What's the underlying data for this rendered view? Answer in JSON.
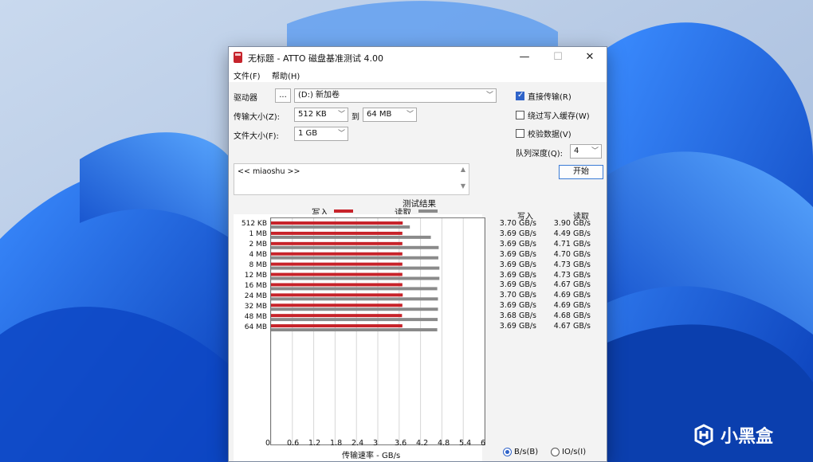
{
  "window": {
    "title": "无标题 - ATTO 磁盘基准测试 4.00",
    "minimize": "—",
    "maximize": "☐",
    "close": "✕"
  },
  "menu": {
    "file": "文件(F)",
    "help": "帮助(H)"
  },
  "controls": {
    "drive_label": "驱动器",
    "browse": "...",
    "drive_value": "(D:) 新加卷",
    "transfer_label": "传输大小(Z):",
    "transfer_from": "512 KB",
    "to_label": "到",
    "transfer_to": "64 MB",
    "file_size_label": "文件大小(F):",
    "file_size": "1 GB",
    "direct_io": "直接传输(R)",
    "bypass_cache": "绕过写入缓存(W)",
    "verify_data": "校验数据(V)",
    "queue_label": "队列深度(Q):",
    "queue_value": "4",
    "start": "开始",
    "notes": "<< miaoshu >>"
  },
  "results": {
    "legend_title": "测试结果",
    "write_label": "写入",
    "read_label": "读取",
    "col_write": "写入",
    "col_read": "读取",
    "axis_title": "传输速率 - GB/s",
    "unit_bs": "B/s(B)",
    "unit_ios": "IO/s(I)"
  },
  "chart_data": {
    "type": "bar",
    "orientation": "horizontal",
    "categories": [
      "512 KB",
      "1 MB",
      "2 MB",
      "4 MB",
      "8 MB",
      "12 MB",
      "16 MB",
      "24 MB",
      "32 MB",
      "48 MB",
      "64 MB"
    ],
    "series": [
      {
        "name": "写入",
        "color": "#c7232a",
        "values": [
          3.7,
          3.69,
          3.69,
          3.69,
          3.69,
          3.69,
          3.69,
          3.7,
          3.69,
          3.68,
          3.69
        ]
      },
      {
        "name": "读取",
        "color": "#8a8a8a",
        "values": [
          3.9,
          4.49,
          4.71,
          4.7,
          4.73,
          4.73,
          4.67,
          4.69,
          4.69,
          4.68,
          4.67
        ]
      }
    ],
    "write_text": [
      "3.70 GB/s",
      "3.69 GB/s",
      "3.69 GB/s",
      "3.69 GB/s",
      "3.69 GB/s",
      "3.69 GB/s",
      "3.69 GB/s",
      "3.70 GB/s",
      "3.69 GB/s",
      "3.68 GB/s",
      "3.69 GB/s"
    ],
    "read_text": [
      "3.90 GB/s",
      "4.49 GB/s",
      "4.71 GB/s",
      "4.70 GB/s",
      "4.73 GB/s",
      "4.73 GB/s",
      "4.67 GB/s",
      "4.69 GB/s",
      "4.69 GB/s",
      "4.68 GB/s",
      "4.67 GB/s"
    ],
    "xticks": [
      "0",
      "0.6",
      "1.2",
      "1.8",
      "2.4",
      "3",
      "3.6",
      "4.2",
      "4.8",
      "5.4",
      "6"
    ],
    "xlim": [
      0,
      6
    ],
    "xlabel": "传输速率 - GB/s"
  },
  "watermark": "小黑盒"
}
